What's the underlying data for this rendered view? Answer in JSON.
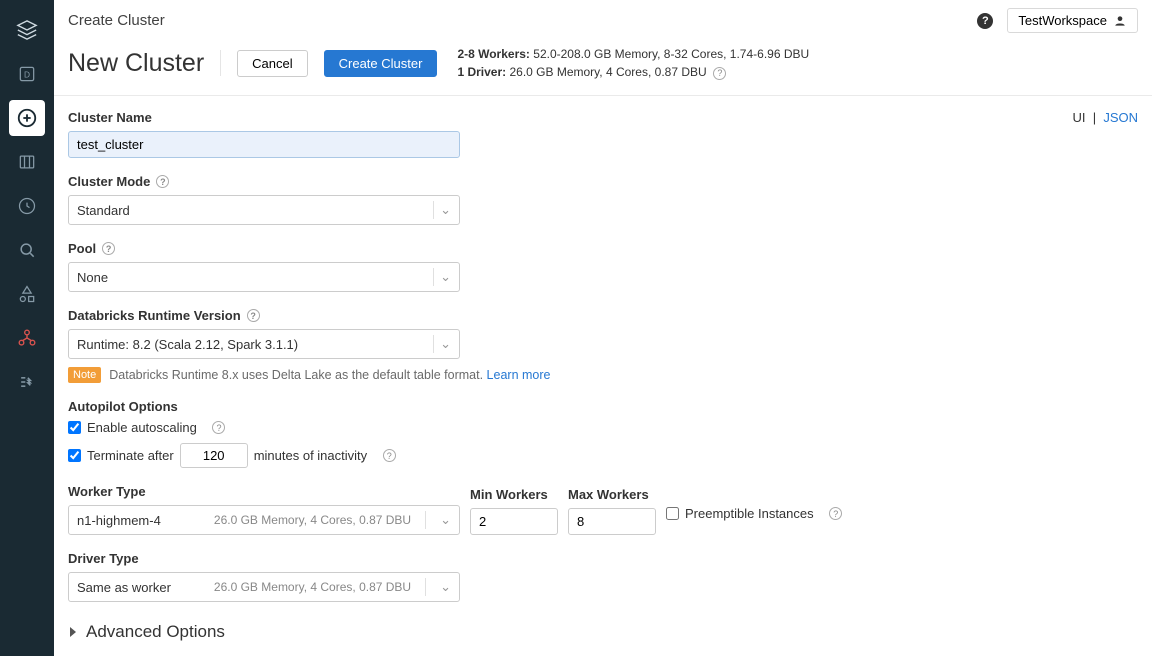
{
  "breadcrumb": "Create Cluster",
  "workspace_name": "TestWorkspace",
  "title": "New Cluster",
  "buttons": {
    "cancel": "Cancel",
    "create": "Create Cluster"
  },
  "summary": {
    "workers_label": "2-8 Workers:",
    "workers_detail": "52.0-208.0 GB Memory, 8-32 Cores, 1.74-6.96 DBU",
    "driver_label": "1 Driver:",
    "driver_detail": "26.0 GB Memory, 4 Cores, 0.87 DBU"
  },
  "view": {
    "ui": "UI",
    "json": "JSON"
  },
  "fields": {
    "cluster_name": {
      "label": "Cluster Name",
      "value": "test_cluster"
    },
    "cluster_mode": {
      "label": "Cluster Mode",
      "value": "Standard"
    },
    "pool": {
      "label": "Pool",
      "value": "None"
    },
    "runtime": {
      "label": "Databricks Runtime Version",
      "value": "Runtime: 8.2 (Scala 2.12, Spark 3.1.1)"
    },
    "autopilot": {
      "label": "Autopilot Options",
      "autoscale": "Enable autoscaling",
      "terminate_prefix": "Terminate after",
      "terminate_value": "120",
      "terminate_suffix": "minutes of inactivity"
    },
    "worker_type": {
      "label": "Worker Type",
      "value": "n1-highmem-4",
      "meta": "26.0 GB Memory, 4 Cores, 0.87 DBU"
    },
    "min_workers": {
      "label": "Min Workers",
      "value": "2"
    },
    "max_workers": {
      "label": "Max Workers",
      "value": "8"
    },
    "preemptible": "Preemptible Instances",
    "driver_type": {
      "label": "Driver Type",
      "value": "Same as worker",
      "meta": "26.0 GB Memory, 4 Cores, 0.87 DBU"
    }
  },
  "note": {
    "badge": "Note",
    "text": "Databricks Runtime 8.x uses Delta Lake as the default table format.",
    "link": "Learn more"
  },
  "advanced": "Advanced Options"
}
